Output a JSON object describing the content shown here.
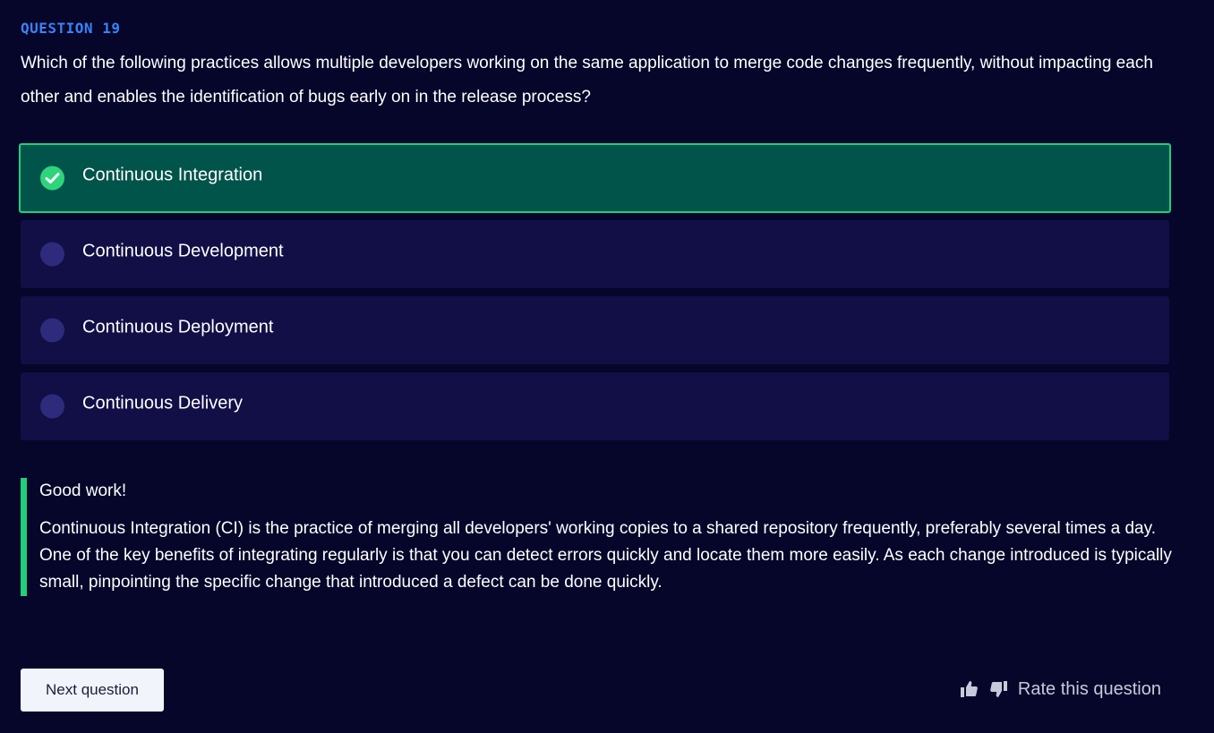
{
  "question": {
    "number_label": "QUESTION 19",
    "text": "Which of the following practices allows multiple developers working on the same application to merge code changes frequently, without impacting each other and enables the identification of bugs early on in the release process?"
  },
  "options": [
    {
      "label": "Continuous Integration",
      "state": "correct"
    },
    {
      "label": "Continuous Development",
      "state": "unselected"
    },
    {
      "label": "Continuous Deployment",
      "state": "unselected"
    },
    {
      "label": "Continuous Delivery",
      "state": "unselected"
    }
  ],
  "feedback": {
    "title": "Good work!",
    "text": "Continuous Integration (CI) is the practice of merging all developers' working copies to a shared repository frequently, preferably several times a day. One of the key benefits of integrating regularly is that you can detect errors quickly and locate them more easily. As each change introduced is typically small, pinpointing the specific change that introduced a defect can be done quickly."
  },
  "actions": {
    "next_label": "Next question",
    "rate_label": "Rate this question",
    "thumbs_up_icon": "thumbs-up-icon",
    "thumbs_down_icon": "thumbs-down-icon"
  },
  "colors": {
    "background": "#05062a",
    "accent_blue": "#3b82f6",
    "correct_green": "#1ecf7c",
    "correct_bg": "#01544a",
    "option_bg": "#110f46"
  }
}
